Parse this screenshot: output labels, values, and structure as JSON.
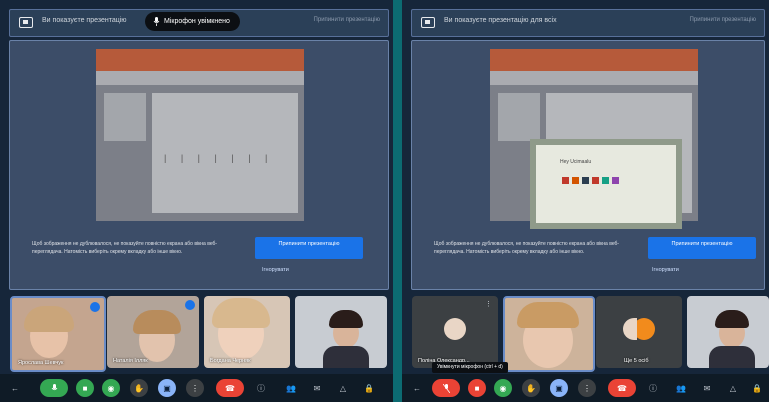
{
  "left": {
    "topbar": {
      "label": "Ви показуєте презентацію",
      "stop_label": "Припинити презентацію"
    },
    "mic_toast": {
      "text": "Мікрофон увімкнено"
    },
    "presentation": {
      "dots": "| | | | | | |"
    },
    "notice": {
      "message": "Щоб зображення не дублювалося, не показуйте повністю екрана або вікна веб-переглядача. Натомість виберіть окрему вкладку або інше вікно.",
      "stop_button": "Припинити презентацію",
      "dismiss": "Ігнорувати"
    },
    "tiles": [
      {
        "name": "Ярослава Шевчук"
      },
      {
        "name": "Наталія Ілляк"
      },
      {
        "name": "Богдана Черняк"
      },
      {
        "name": ""
      }
    ]
  },
  "right": {
    "topbar": {
      "label": "Ви показуєте презентацію для всіх",
      "stop_label": "Припинити презентацію"
    },
    "presentation": {
      "slide_title": "Hey Ucimaalu"
    },
    "notice": {
      "message": "Щоб зображення не дублювалося, не показуйте повністю екрана або вікна веб-переглядача. Натомість виберіть окрему вкладку або інше вікно.",
      "stop_button": "Припинити презентацію",
      "dismiss": "Ігнорувати"
    },
    "tiles": [
      {
        "name": "Поліна Олександр..."
      },
      {
        "name": ""
      },
      {
        "name": "Ще 5 осіб"
      },
      {
        "name": ""
      }
    ],
    "tooltip": "Увімкнути мікрофон (ctrl + d)"
  },
  "colors": {
    "accent_blue": "#1a73e8",
    "end_call_red": "#ea4335",
    "mic_green": "#34a853",
    "divider_teal": "#0c6b72"
  },
  "icons": {
    "toolbar": [
      "arrow-icon",
      "mic-icon",
      "camera-icon",
      "captions-icon",
      "hand-icon",
      "present-icon",
      "more-icon",
      "end-call-icon",
      "info-icon",
      "people-icon",
      "chat-icon",
      "activities-icon",
      "lock-icon"
    ]
  }
}
